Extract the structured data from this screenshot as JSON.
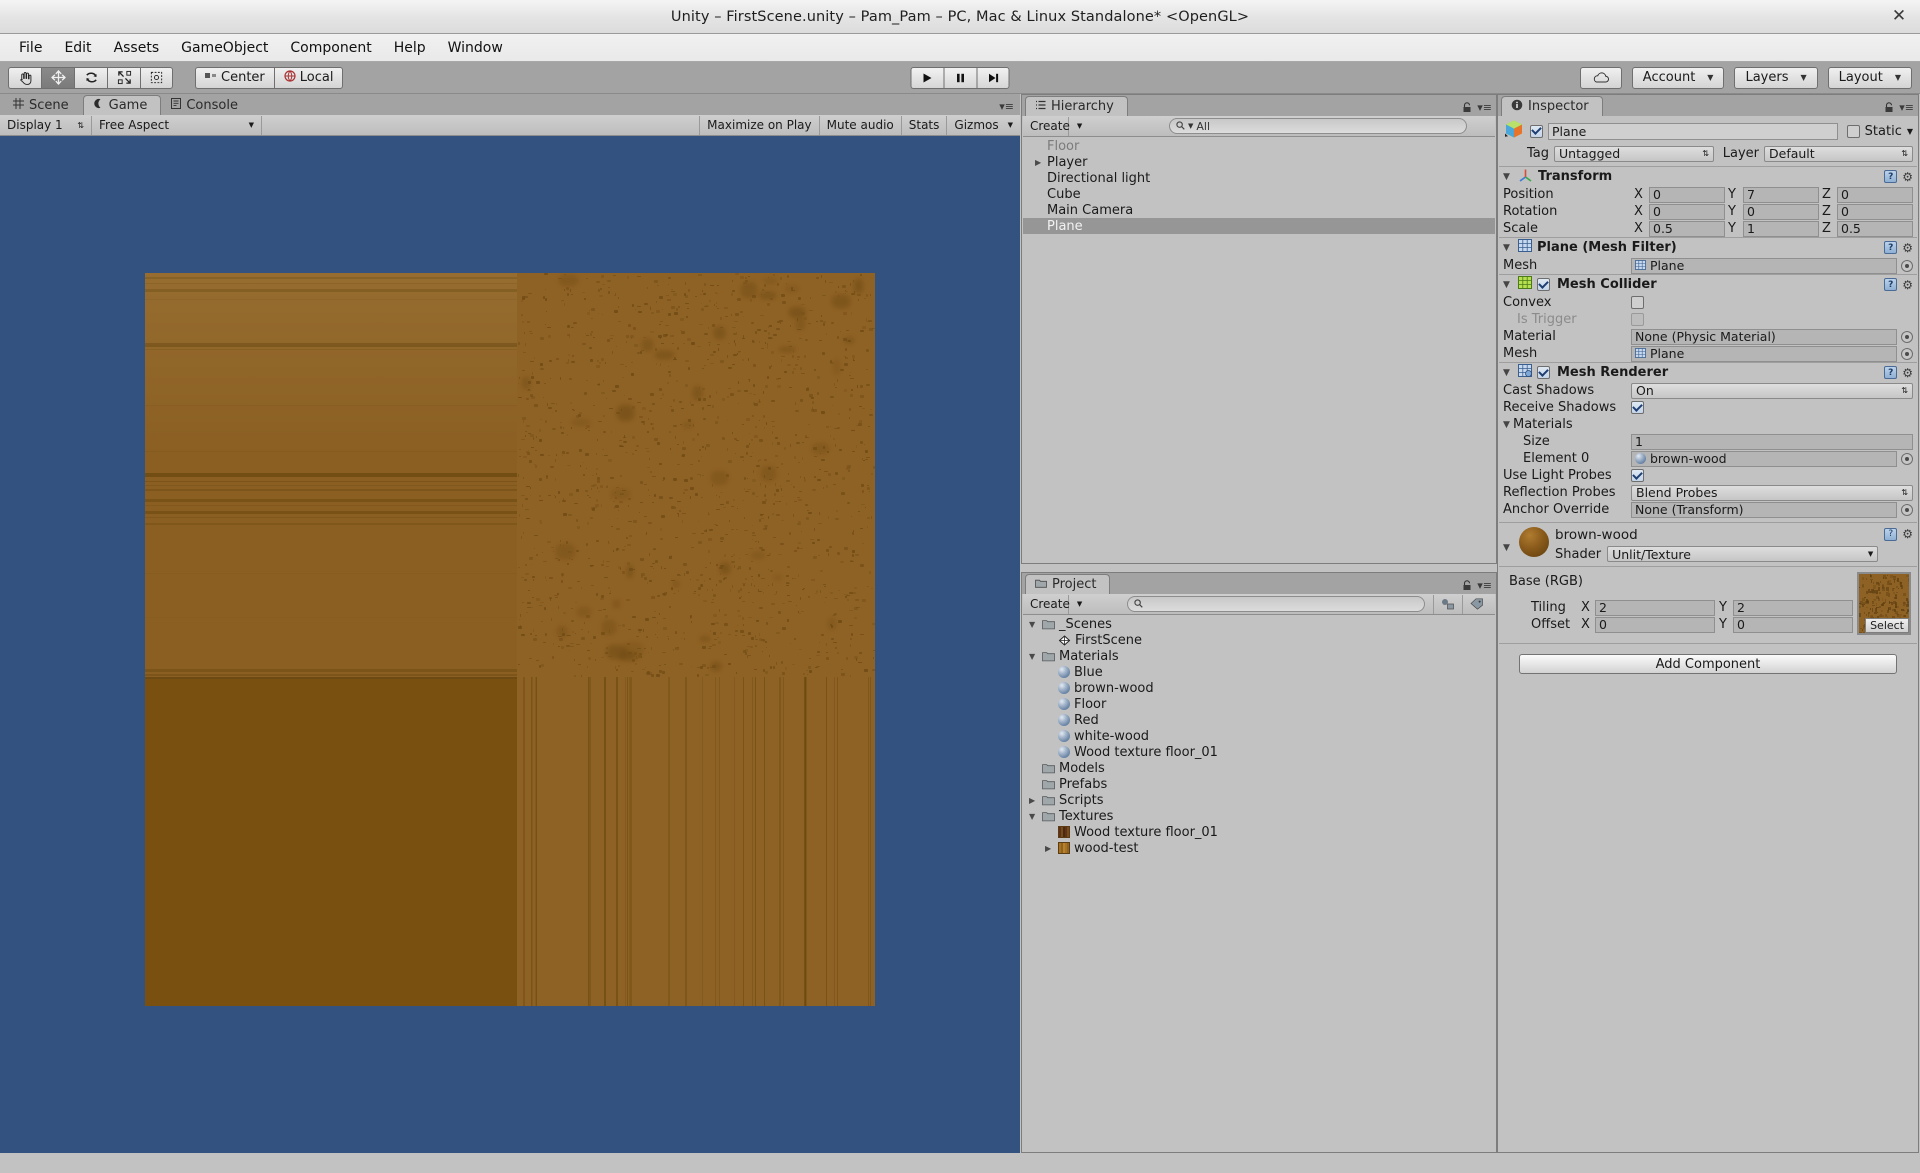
{
  "window": {
    "title": "Unity – FirstScene.unity – Pam_Pam – PC, Mac & Linux Standalone* <OpenGL>",
    "close_label": "✕"
  },
  "menubar": {
    "items": [
      "File",
      "Edit",
      "Assets",
      "GameObject",
      "Component",
      "Help",
      "Window"
    ]
  },
  "toolbar": {
    "tools": [
      {
        "name": "hand-tool",
        "active": false
      },
      {
        "name": "move-tool",
        "active": true
      },
      {
        "name": "rotate-tool",
        "active": false
      },
      {
        "name": "scale-tool",
        "active": false
      },
      {
        "name": "rect-tool",
        "active": false
      }
    ],
    "pivot_label": "Center",
    "space_label": "Local",
    "play_label": "▶",
    "pause_label": "❚❚",
    "step_label": "▶❙",
    "cloud_label": "☁",
    "account_label": "Account",
    "layers_label": "Layers",
    "layout_label": "Layout",
    "caret": "▼"
  },
  "view_tabs": [
    {
      "label": "Scene",
      "icon": "grid-icon",
      "active": false
    },
    {
      "label": "Game",
      "icon": "gamepad-icon",
      "active": true
    },
    {
      "label": "Console",
      "icon": "console-icon",
      "active": false
    }
  ],
  "game_toolbar": {
    "display": "Display 1",
    "aspect": "Free Aspect",
    "maximize_on_play": "Maximize on Play",
    "mute_audio": "Mute audio",
    "stats": "Stats",
    "gizmos": "Gizmos"
  },
  "game_view": {
    "background_color": "#34527f",
    "plane_base_color": "#8e6124",
    "plane_dark_color": "#79500f",
    "grain_color": "#6d4a11"
  },
  "hierarchy": {
    "tab_label": "Hierarchy",
    "create_label": "Create",
    "search_placeholder": "All",
    "search_icon": "search-icon",
    "items": [
      {
        "label": "Floor",
        "expandable": false,
        "dim": true,
        "selected": false
      },
      {
        "label": "Player",
        "expandable": true,
        "dim": false,
        "selected": false
      },
      {
        "label": "Directional light",
        "expandable": false,
        "dim": false,
        "selected": false
      },
      {
        "label": "Cube",
        "expandable": false,
        "dim": false,
        "selected": false
      },
      {
        "label": "Main Camera",
        "expandable": false,
        "dim": false,
        "selected": false
      },
      {
        "label": "Plane",
        "expandable": false,
        "dim": false,
        "selected": true
      }
    ]
  },
  "project": {
    "tab_label": "Project",
    "create_label": "Create",
    "search_value": "",
    "items": [
      {
        "label": "_Scenes",
        "indent": 0,
        "icon": "folder-icon",
        "arrow": "down"
      },
      {
        "label": "FirstScene",
        "indent": 1,
        "icon": "unity-icon",
        "arrow": "none"
      },
      {
        "label": "Materials",
        "indent": 0,
        "icon": "folder-icon",
        "arrow": "down"
      },
      {
        "label": "Blue",
        "indent": 1,
        "icon": "material-icon",
        "arrow": "none"
      },
      {
        "label": "brown-wood",
        "indent": 1,
        "icon": "material-icon",
        "arrow": "none"
      },
      {
        "label": "Floor",
        "indent": 1,
        "icon": "material-icon",
        "arrow": "none"
      },
      {
        "label": "Red",
        "indent": 1,
        "icon": "material-icon",
        "arrow": "none"
      },
      {
        "label": "white-wood",
        "indent": 1,
        "icon": "material-icon",
        "arrow": "none"
      },
      {
        "label": "Wood texture floor_01",
        "indent": 1,
        "icon": "material-icon",
        "arrow": "none"
      },
      {
        "label": "Models",
        "indent": 0,
        "icon": "folder-icon",
        "arrow": "none"
      },
      {
        "label": "Prefabs",
        "indent": 0,
        "icon": "folder-icon",
        "arrow": "none"
      },
      {
        "label": "Scripts",
        "indent": 0,
        "icon": "folder-icon",
        "arrow": "right"
      },
      {
        "label": "Textures",
        "indent": 0,
        "icon": "folder-icon",
        "arrow": "down"
      },
      {
        "label": "Wood texture floor_01",
        "indent": 1,
        "icon": "texture-icon-dark",
        "arrow": "none"
      },
      {
        "label": "wood-test",
        "indent": 1,
        "icon": "texture-icon-light",
        "arrow": "right"
      }
    ]
  },
  "inspector": {
    "tab_label": "Inspector",
    "object_name": "Plane",
    "object_enabled": true,
    "static_label": "Static",
    "static_checked": false,
    "tag_label": "Tag",
    "tag_value": "Untagged",
    "layer_label": "Layer",
    "layer_value": "Default",
    "transform": {
      "title": "Transform",
      "rows": [
        {
          "label": "Position",
          "x": "0",
          "y": "7",
          "z": "0"
        },
        {
          "label": "Rotation",
          "x": "0",
          "y": "0",
          "z": "0"
        },
        {
          "label": "Scale",
          "x": "0.5",
          "y": "1",
          "z": "0.5"
        }
      ]
    },
    "mesh_filter": {
      "title": "Plane (Mesh Filter)",
      "mesh_label": "Mesh",
      "mesh_value": "Plane"
    },
    "mesh_collider": {
      "title": "Mesh Collider",
      "enabled": true,
      "convex_label": "Convex",
      "convex_checked": false,
      "is_trigger_label": "Is Trigger",
      "is_trigger_checked": false,
      "material_label": "Material",
      "material_value": "None (Physic Material)",
      "mesh_label": "Mesh",
      "mesh_value": "Plane"
    },
    "mesh_renderer": {
      "title": "Mesh Renderer",
      "enabled": true,
      "cast_shadows_label": "Cast Shadows",
      "cast_shadows_value": "On",
      "receive_shadows_label": "Receive Shadows",
      "receive_shadows_checked": true,
      "materials_label": "Materials",
      "size_label": "Size",
      "size_value": "1",
      "element0_label": "Element 0",
      "element0_value": "brown-wood",
      "use_light_probes_label": "Use Light Probes",
      "use_light_probes_checked": true,
      "reflection_probes_label": "Reflection Probes",
      "reflection_probes_value": "Blend Probes",
      "anchor_override_label": "Anchor Override",
      "anchor_override_value": "None (Transform)"
    },
    "material": {
      "name": "brown-wood",
      "shader_label": "Shader",
      "shader_value": "Unlit/Texture",
      "base_label": "Base (RGB)",
      "tiling_label": "Tiling",
      "tiling_x": "2",
      "tiling_y": "2",
      "offset_label": "Offset",
      "offset_x": "0",
      "offset_y": "0",
      "select_label": "Select",
      "axis_x": "X",
      "axis_y": "Y"
    },
    "add_component_label": "Add Component"
  },
  "colors": {
    "panel_bg": "#c2c2c2",
    "chrome_bg": "#a3a3a3",
    "selection": "#969696",
    "game_bg": "#34527f"
  }
}
